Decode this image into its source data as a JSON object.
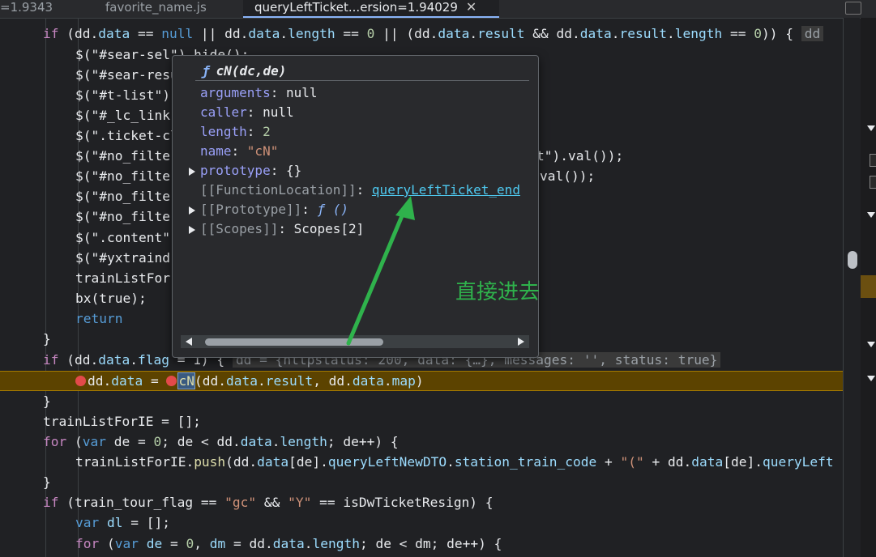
{
  "tabs": [
    {
      "label": "=1.9343"
    },
    {
      "label": "favorite_name.js"
    },
    {
      "label": "queryLeftTicket...ersion=1.94029",
      "close": "✕"
    }
  ],
  "code": {
    "l1_a": "if",
    "l1_b": " (dd.",
    "l1_c": "data",
    "l1_d": " == ",
    "l1_e": "null",
    "l1_f": " || dd.",
    "l1_g": "data",
    "l1_h": ".",
    "l1_i": "length",
    "l1_j": " == ",
    "l1_k": "0",
    "l1_l": " || (dd.",
    "l1_m": "data",
    "l1_n": ".",
    "l1_o": "result",
    "l1_p": " && dd.",
    "l1_q": "data",
    "l1_r": ".",
    "l1_s": "result",
    "l1_t": ".",
    "l1_u": "length",
    "l1_v": " == ",
    "l1_w": "0",
    "l1_x": ")) {",
    "l1_badge": "dd",
    "l2": "$(\"#sear-sel\").hide();",
    "l3": "$(\"#sear-resu",
    "l4": "$(\"#t-list\")",
    "l5": "$(\"#_lc_link",
    "l6": "$(\".ticket-cl",
    "l7_a": "$(\"#no_filte",
    "l7_b": "t\").val());",
    "l8_a": "$(\"#no_filte",
    "l8_b": "val());",
    "l9": "$(\"#no_filte",
    "l10": "$(\"#no_filte",
    "l11": "$(\".content\"",
    "l12": "$(\"#yxtraind",
    "l13": "trainListFor",
    "l14": "bx(true);",
    "l15": "return",
    "l16": "}",
    "l17_a": "if",
    "l17_b": " (dd.",
    "l17_c": "data",
    "l17_d": ".",
    "l17_e": "flag",
    "l17_f": " = 1) {",
    "l17_inline": "dd = {httpstatus: 200, data: {…}, messages: '', status: true}",
    "l18_a": "dd.",
    "l18_b": "data",
    "l18_c": " = ",
    "l18_d": "cN",
    "l18_e": "(dd.",
    "l18_f": "data",
    "l18_g": ".",
    "l18_h": "result",
    "l18_i": ", dd.",
    "l18_j": "data",
    "l18_k": ".",
    "l18_l": "map",
    "l18_m": ")",
    "l19": "}",
    "l20": "trainListForIE = [];",
    "l21_a": "for",
    "l21_b": " (",
    "l21_c": "var",
    "l21_d": " de = ",
    "l21_e": "0",
    "l21_f": "; de < dd.",
    "l21_g": "data",
    "l21_h": ".",
    "l21_i": "length",
    "l21_j": "; de++) {",
    "l22_a": "trainListForIE.",
    "l22_b": "push",
    "l22_c": "(dd.",
    "l22_d": "data",
    "l22_e": "[de].",
    "l22_f": "queryLeftNewDTO",
    "l22_g": ".",
    "l22_h": "station_train_code",
    "l22_i": " + ",
    "l22_j": "\"(\"",
    "l22_k": " + dd.",
    "l22_l": "data",
    "l22_m": "[de].",
    "l22_n": "queryLeft",
    "l23": "}",
    "l24_a": "if",
    "l24_b": " (train_tour_flag == ",
    "l24_c": "\"gc\"",
    "l24_d": " && ",
    "l24_e": "\"Y\"",
    "l24_f": " == isDwTicketResign) {",
    "l25_a": "var",
    "l25_b": " ",
    "l25_c": "dl",
    "l25_d": " = [];",
    "l26_a": "for",
    "l26_b": " (",
    "l26_c": "var",
    "l26_d": " ",
    "l26_e": "de",
    "l26_f": " = ",
    "l26_g": "0",
    "l26_h": ", ",
    "l26_i": "dm",
    "l26_j": " = dd.",
    "l26_k": "data",
    "l26_l": ".",
    "l26_m": "length",
    "l26_n": "; de < dm; de++) {"
  },
  "popup": {
    "fn_symbol": "ƒ",
    "title": "cN(dc,de)",
    "props": [
      {
        "key": "arguments",
        "value": "null"
      },
      {
        "key": "caller",
        "value": "null"
      },
      {
        "key": "length",
        "value": "2"
      },
      {
        "key": "name",
        "value": "\"cN\""
      },
      {
        "key": "prototype",
        "value": "{}"
      },
      {
        "key": "[[FunctionLocation]]",
        "value": "queryLeftTicket_end"
      },
      {
        "key": "[[Prototype]]",
        "value": "ƒ ()"
      },
      {
        "key": "[[Scopes]]",
        "value": "Scopes[2]"
      }
    ]
  },
  "annotation": {
    "text": "直接进去",
    "color": "#2fb24c"
  },
  "colors": {
    "accent": "#8ab4f8",
    "highlight_line": "#5c4300",
    "breakpoint": "#e24a4a"
  }
}
